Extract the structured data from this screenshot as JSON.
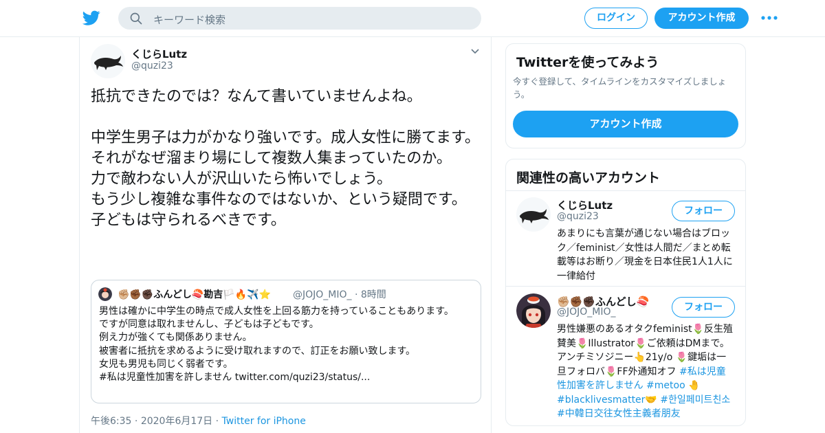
{
  "header": {
    "search_placeholder": "キーワード検索",
    "login_label": "ログイン",
    "signup_label": "アカウント作成",
    "brand_color": "#1da1f2"
  },
  "tweet": {
    "author_name": "くじらLutz",
    "author_handle": "@quzi23",
    "text": "抵抗できたのでは？なんて書いていませんよね。\n\n中学生男子は力がかなり強いです。成人女性に勝てます。それがなぜ溜まり場にして複数人集まっていたのか。\n力で敵わない人が沢山いたら怖いでしょう。\nもう少し複雑な事件なのではないか、という疑問です。\n子どもは守られるべきです。",
    "time": "午後6:35",
    "date": "2020年6月17日",
    "source": "Twitter for iPhone",
    "quote": {
      "name": "✊🏼✊🏾✊🏿ふんどし🍣勘吉🏳️🔥✈️⭐",
      "handle": "@JOJO_MIO_",
      "time_ago": "8時間",
      "text": "男性は確かに中学生の時点で成人女性を上回る筋力を持っていることもあります。\nですが同意は取れませんし、子どもは子どもです。\n例え力が強くても関係ありません。\n被害者に抵抗を求めるように受け取れますので、訂正をお願い致します。\n女児も男児も同じく弱者です。\n#私は児童性加害を許しません twitter.com/quzi23/status/..."
    }
  },
  "sidebar": {
    "try_card": {
      "title": "Twitterを使ってみよう",
      "subtitle": "今すぐ登録して、タイムラインをカスタマイズしましょう。",
      "cta": "アカウント作成"
    },
    "related": {
      "title": "関連性の高いアカウント",
      "follow_label": "フォロー",
      "accounts": [
        {
          "name": "くじらLutz",
          "handle": "@quzi23",
          "bio": "あまりにも言葉が通じない場合はブロック／feminist／女性は人間だ／まとめ転載等はお断り／現金を日本住民1人1人に一律給付"
        },
        {
          "name": "✊🏼✊🏾✊🏿ふんどし🍣",
          "handle": "@JOJO_MIO_",
          "bio_plain": "男性嫌悪のあるオタクfeminist🌷反生殖賛美🌷Illustrator🌷ご依頼はDMまで。アンチミソジニー👆21y/o 🌷鍵垢は一旦フォロバ🌷FF外通知オフ ",
          "bio_tags": "#私は児童性加害を許しません #metoo 🤚 #blacklivesmatter🤝 #한일페미트친소 #中韓日交往女性主義者朋友"
        }
      ]
    }
  }
}
